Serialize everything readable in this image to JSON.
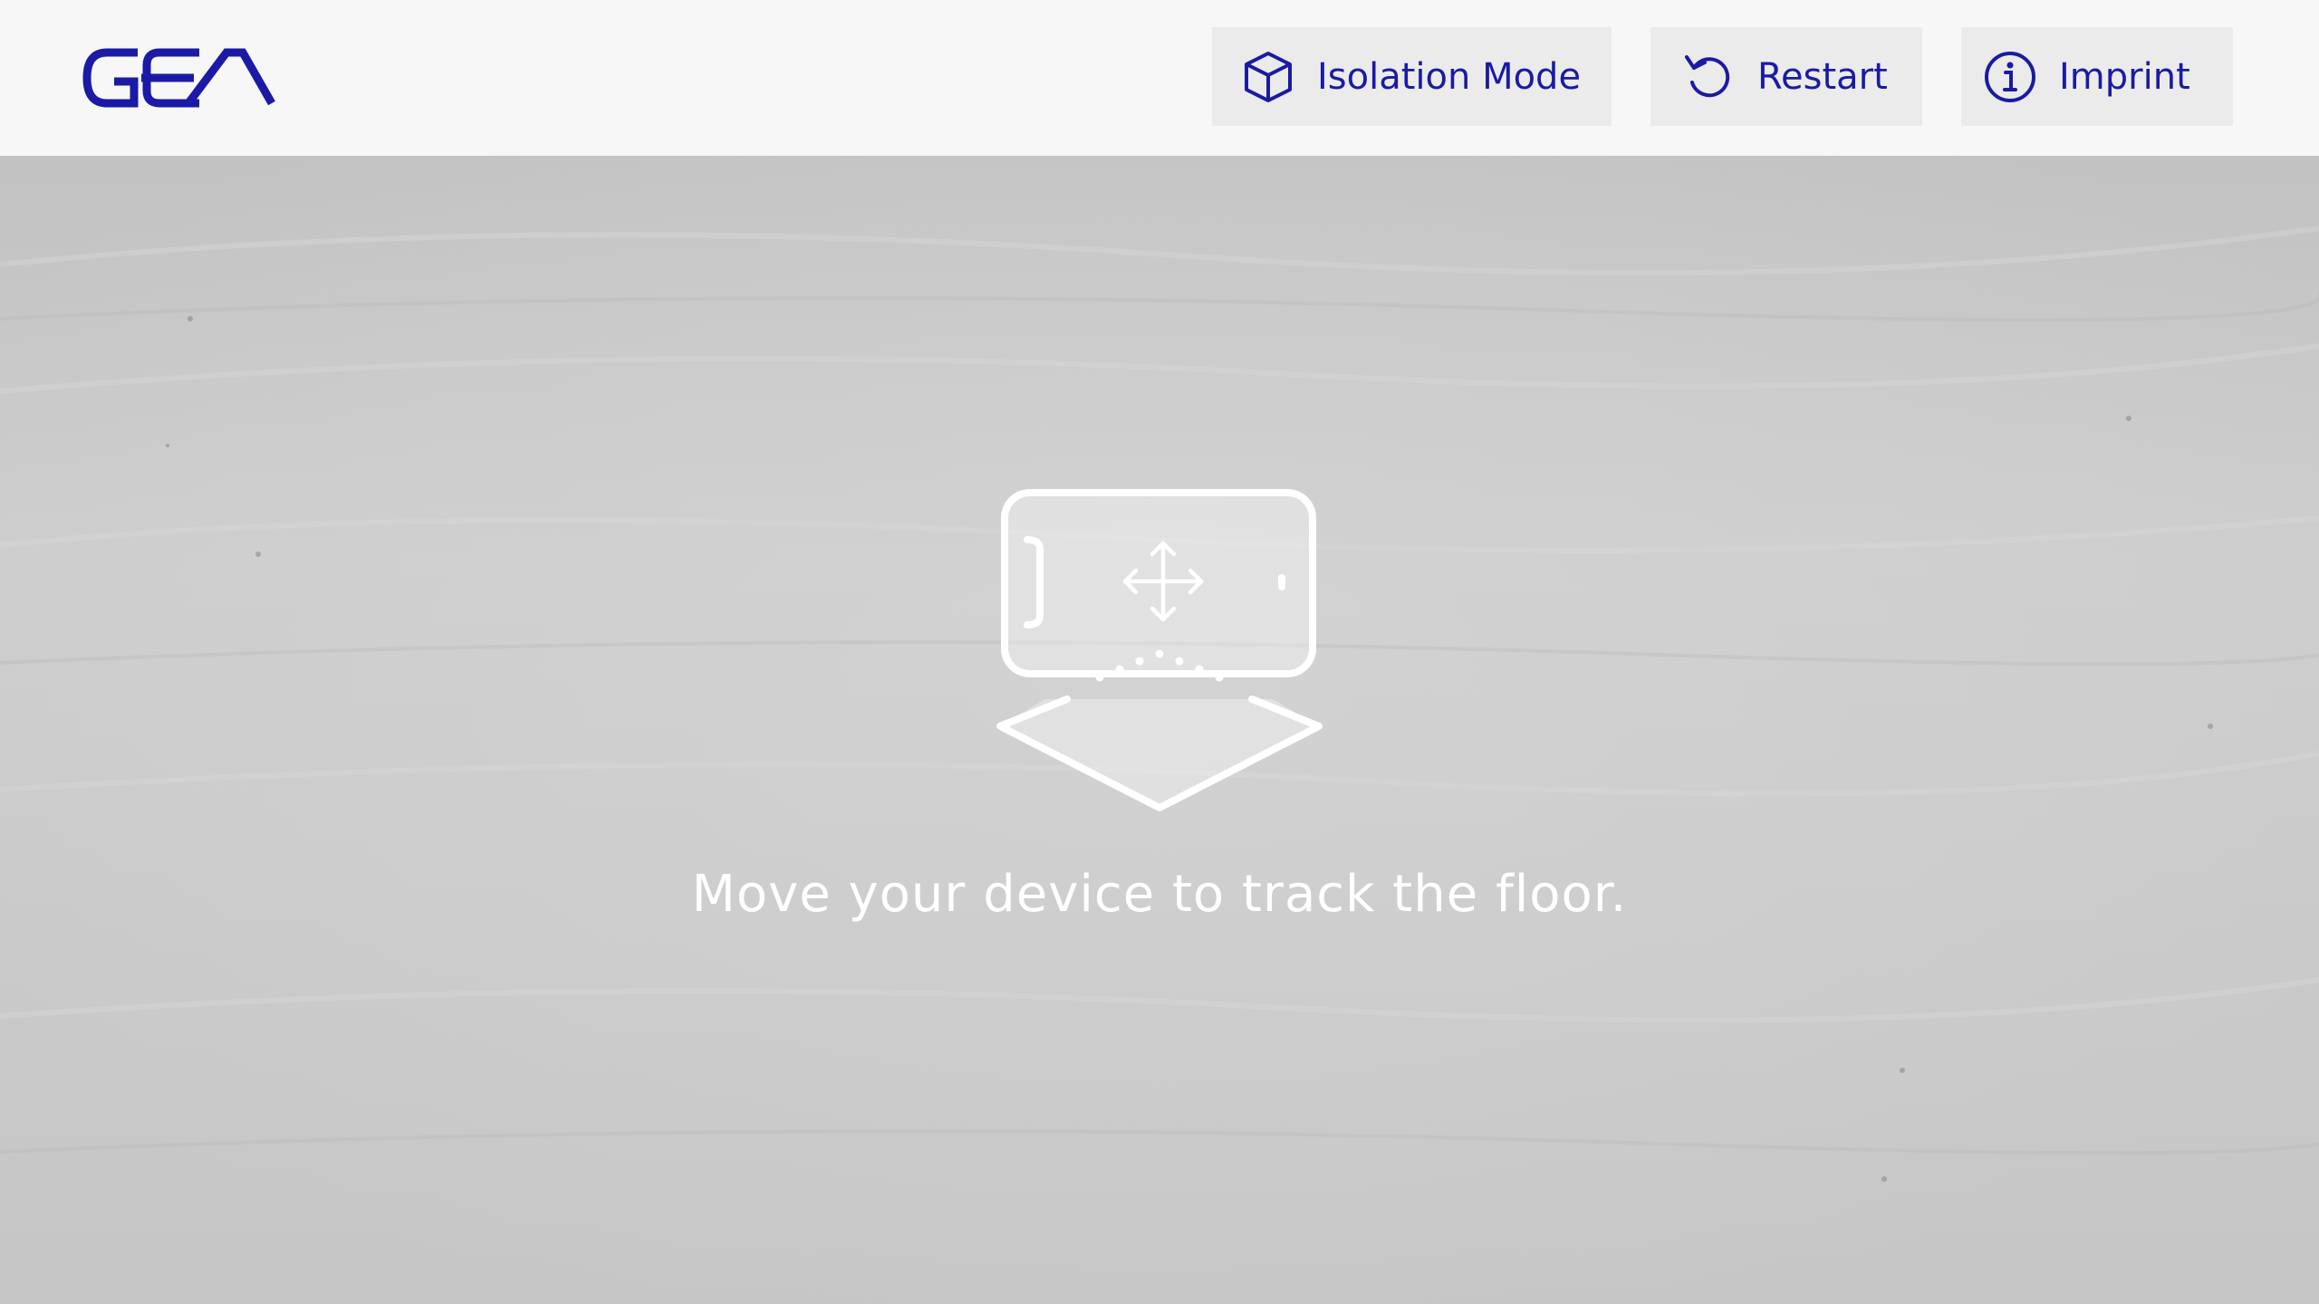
{
  "header": {
    "logo_text": "GEA",
    "buttons": {
      "isolation_mode": {
        "label": "Isolation Mode",
        "icon": "cube-icon"
      },
      "restart": {
        "label": "Restart",
        "icon": "restart-icon"
      },
      "imprint": {
        "label": "Imprint",
        "icon": "info-icon"
      }
    }
  },
  "overlay": {
    "graphic_icon": "phone-move-floor-icon",
    "message": "Move your device to track the floor."
  },
  "colors": {
    "brand_blue": "#1a1aa6",
    "topbar_bg": "#f7f7f7",
    "button_bg": "#ebebeb",
    "floor_gray": "#cbcbcb",
    "hint_white": "#ffffff"
  }
}
